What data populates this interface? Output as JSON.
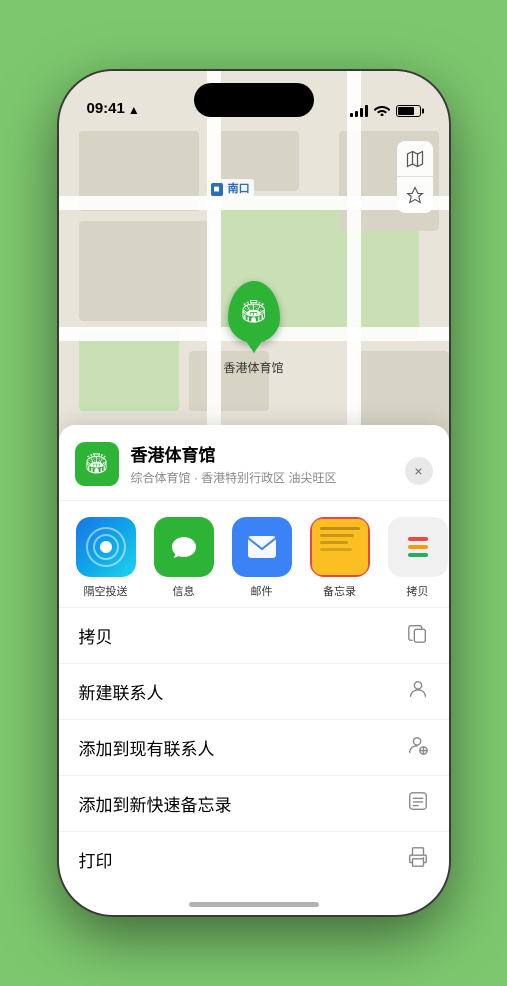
{
  "status_bar": {
    "time": "09:41",
    "location_arrow": "▲"
  },
  "map": {
    "label": "南口",
    "venue_marker": {
      "name": "香港体育馆",
      "icon": "🏟️"
    }
  },
  "map_controls": {
    "map_icon": "🗺",
    "location_icon": "➤"
  },
  "venue_card": {
    "name": "香港体育馆",
    "subtitle": "综合体育馆 · 香港特别行政区 油尖旺区",
    "close": "×"
  },
  "share_row": {
    "items": [
      {
        "id": "airdrop",
        "label": "隔空投送",
        "type": "airdrop"
      },
      {
        "id": "messages",
        "label": "信息",
        "type": "messages"
      },
      {
        "id": "mail",
        "label": "邮件",
        "type": "mail"
      },
      {
        "id": "notes",
        "label": "备忘录",
        "type": "notes"
      },
      {
        "id": "more",
        "label": "拷贝",
        "type": "more"
      }
    ]
  },
  "action_list": [
    {
      "id": "copy",
      "label": "拷贝",
      "icon": "⿻"
    },
    {
      "id": "new-contact",
      "label": "新建联系人",
      "icon": "👤"
    },
    {
      "id": "add-existing",
      "label": "添加到现有联系人",
      "icon": "👤"
    },
    {
      "id": "add-note",
      "label": "添加到新快速备忘录",
      "icon": "📋"
    },
    {
      "id": "print",
      "label": "打印",
      "icon": "🖨"
    }
  ]
}
